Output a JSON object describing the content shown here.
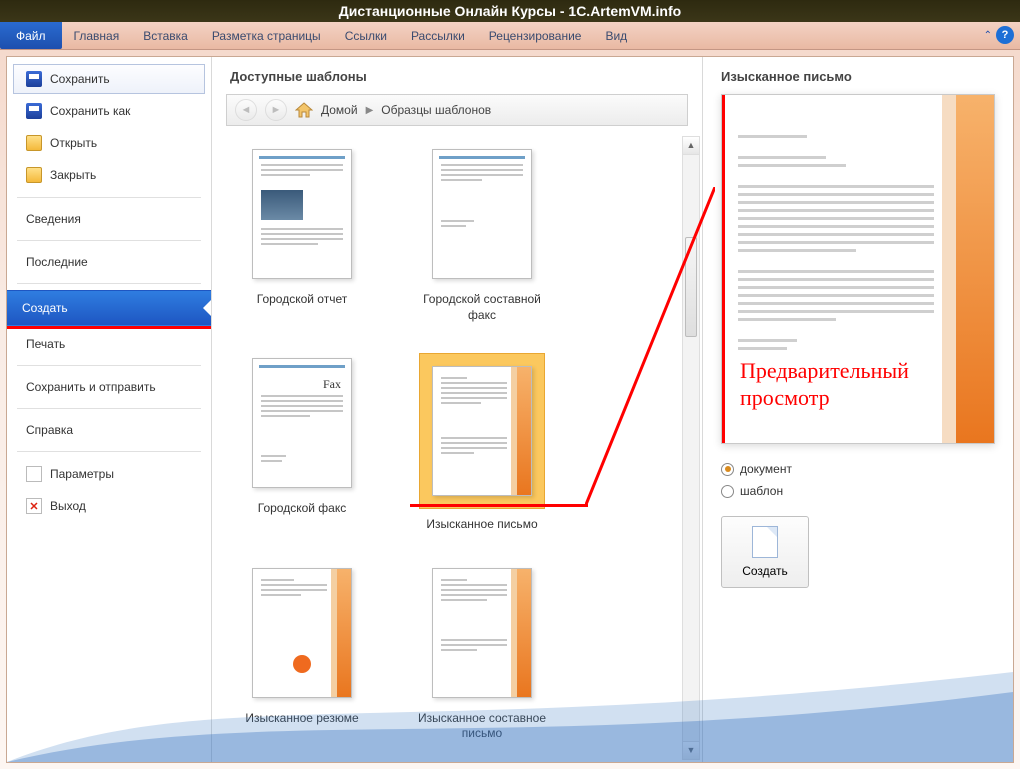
{
  "title": "Дистанционные Онлайн Курсы - 1C.ArtemVM.info",
  "ribbon": {
    "file": "Файл",
    "tabs": [
      "Главная",
      "Вставка",
      "Разметка страницы",
      "Ссылки",
      "Рассылки",
      "Рецензирование",
      "Вид"
    ]
  },
  "sidebar": {
    "save": "Сохранить",
    "save_as": "Сохранить как",
    "open": "Открыть",
    "close": "Закрыть",
    "info": "Сведения",
    "recent": "Последние",
    "create": "Создать",
    "print": "Печать",
    "save_send": "Сохранить и отправить",
    "help": "Справка",
    "params": "Параметры",
    "exit": "Выход"
  },
  "gallery": {
    "header": "Доступные шаблоны",
    "home": "Домой",
    "crumb2": "Образцы шаблонов",
    "templates": {
      "t1": "Городской отчет",
      "t2": "Городской составной факс",
      "t3": "Городской факс",
      "t4": "Изысканное письмо",
      "t5": "Изысканное резюме",
      "t6": "Изысканное составное письмо"
    },
    "fax_word": "Fax"
  },
  "preview": {
    "title": "Изысканное письмо",
    "annotation": "Предварительный просмотр",
    "radio_doc": "документ",
    "radio_tpl": "шаблон",
    "create_btn": "Создать"
  }
}
